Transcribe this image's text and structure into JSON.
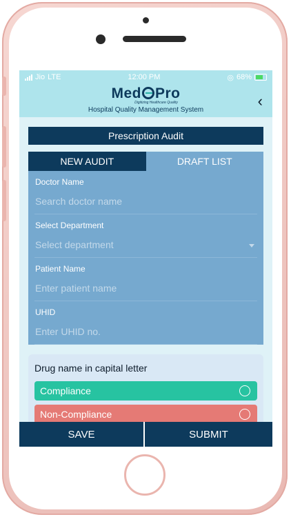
{
  "status_bar": {
    "carrier": "Jio",
    "network": "LTE",
    "time": "12:00 PM",
    "battery": "68%"
  },
  "header": {
    "logo_left": "Med",
    "logo_right": "Pro",
    "tagline": "Digitizing Healthcare Quality",
    "subtitle": "Hospital Quality Management System",
    "back_icon": "chevron-left-icon"
  },
  "page": {
    "title": "Prescription Audit"
  },
  "tabs": [
    {
      "label": "NEW AUDIT",
      "active": true
    },
    {
      "label": "DRAFT LIST",
      "active": false
    }
  ],
  "form": {
    "doctor": {
      "label": "Doctor Name",
      "placeholder": "Search doctor name"
    },
    "department": {
      "label": "Select Department",
      "placeholder": "Select department"
    },
    "patient": {
      "label": "Patient Name",
      "placeholder": "Enter patient name"
    },
    "uhid": {
      "label": "UHID",
      "placeholder": "Enter UHID no."
    }
  },
  "drug_card": {
    "title": "Drug name in capital letter",
    "options": [
      {
        "label": "Compliance"
      },
      {
        "label": "Non-Compliance"
      }
    ]
  },
  "footer": {
    "save_label": "SAVE",
    "submit_label": "SUBMIT"
  },
  "colors": {
    "navy": "#0d3a5c",
    "tab_inactive": "#76a9cf",
    "header_bg": "#aee4ec",
    "compliance": "#27c3a1",
    "non_compliance": "#e57a75"
  }
}
